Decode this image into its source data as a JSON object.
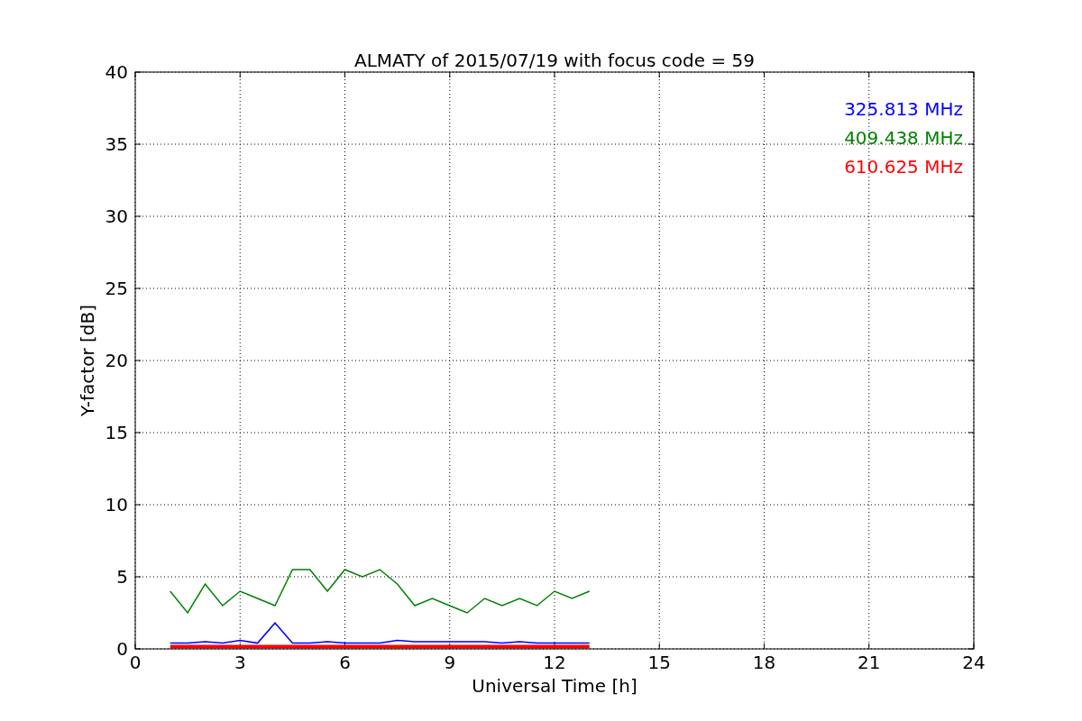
{
  "chart_data": {
    "type": "line",
    "title": "ALMATY of 2015/07/19 with focus code = 59",
    "xlabel": "Universal Time [h]",
    "ylabel": "Y-factor [dB]",
    "x": [
      1,
      1.5,
      2,
      2.5,
      3,
      3.5,
      4,
      4.5,
      5,
      5.5,
      6,
      6.5,
      7,
      7.5,
      8,
      8.5,
      9,
      9.5,
      10,
      10.5,
      11,
      11.5,
      12,
      12.5,
      13
    ],
    "series": [
      {
        "name": "325.813 MHz",
        "color": "#0000ff",
        "values": [
          0.4,
          0.4,
          0.5,
          0.4,
          0.6,
          0.4,
          1.8,
          0.4,
          0.4,
          0.5,
          0.4,
          0.4,
          0.4,
          0.6,
          0.5,
          0.5,
          0.5,
          0.5,
          0.5,
          0.4,
          0.5,
          0.4,
          0.4,
          0.4,
          0.4
        ]
      },
      {
        "name": "409.438 MHz",
        "color": "#008000",
        "values": [
          4,
          2.5,
          4.5,
          3,
          4,
          3.5,
          3,
          5.5,
          5.5,
          4,
          5.5,
          5,
          5.5,
          4.5,
          3,
          3.5,
          3,
          2.5,
          3.5,
          3,
          3.5,
          3,
          4,
          3.5,
          4
        ]
      },
      {
        "name": "610.625 MHz",
        "color": "#ff0000",
        "values": [
          0.15,
          0.15,
          0.15,
          0.15,
          0.15,
          0.15,
          0.15,
          0.15,
          0.15,
          0.15,
          0.15,
          0.15,
          0.15,
          0.15,
          0.15,
          0.15,
          0.15,
          0.15,
          0.15,
          0.15,
          0.15,
          0.15,
          0.15,
          0.15,
          0.15
        ]
      }
    ],
    "grid": true,
    "xlim": [
      0,
      24
    ],
    "ylim": [
      0,
      40
    ],
    "xticks": [
      0,
      3,
      6,
      9,
      12,
      15,
      18,
      21,
      24
    ],
    "yticks": [
      0,
      5,
      10,
      15,
      20,
      25,
      30,
      35,
      40
    ]
  }
}
